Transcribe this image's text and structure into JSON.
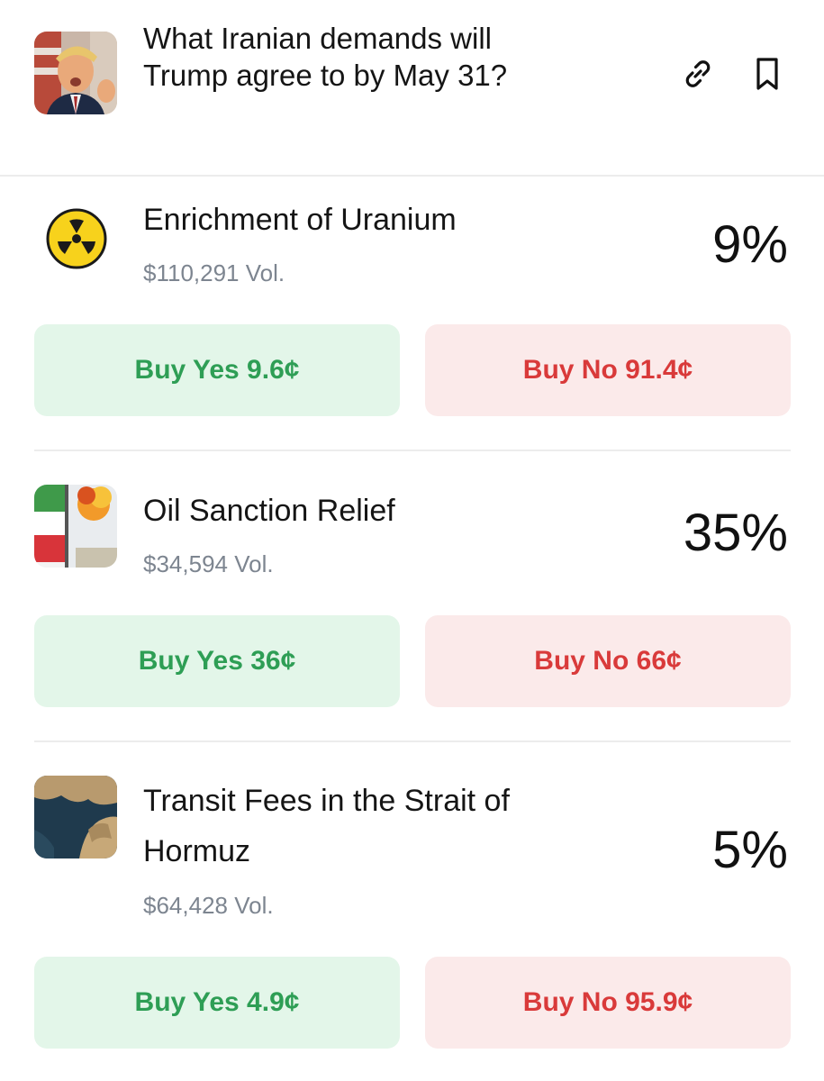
{
  "header": {
    "title": "What Iranian demands will Trump agree to by May 31?",
    "thumbnail_icon": "person-photo-icon",
    "link_icon": "link-icon",
    "bookmark_icon": "bookmark-icon"
  },
  "markets": [
    {
      "title": "Enrichment of Uranium",
      "volume": "$110,291 Vol.",
      "percent": "9%",
      "yes_label": "Buy Yes 9.6¢",
      "no_label": "Buy No 91.4¢",
      "icon": "radiation-icon"
    },
    {
      "title": "Oil Sanction Relief",
      "volume": "$34,594 Vol.",
      "percent": "35%",
      "yes_label": "Buy Yes 36¢",
      "no_label": "Buy No 66¢",
      "icon": "iran-flag-fire-icon"
    },
    {
      "title": "Transit Fees in the Strait of Hormuz",
      "volume": "$64,428 Vol.",
      "percent": "5%",
      "yes_label": "Buy Yes 4.9¢",
      "no_label": "Buy No 95.9¢",
      "icon": "satellite-map-icon"
    }
  ],
  "colors": {
    "yes_bg": "#e3f6e9",
    "yes_text": "#2e9e55",
    "no_bg": "#fbeaea",
    "no_text": "#d93a3a",
    "volume_text": "#7d8590"
  }
}
